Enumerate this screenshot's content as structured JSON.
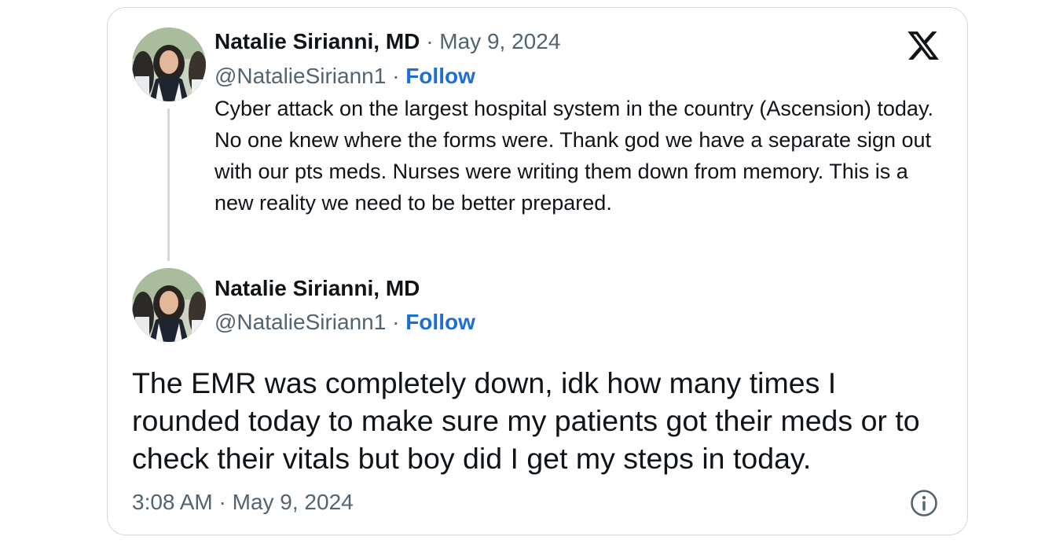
{
  "quoted_tweet": {
    "author_name": "Natalie Sirianni, MD",
    "date": "May 9, 2024",
    "handle": "@NatalieSiriann1",
    "follow_label": "Follow",
    "text": "Cyber attack on the largest hospital system in the country (Ascension) today. No one knew where the forms were. Thank god we have a separate sign out with our pts meds. Nurses were writing them down from memory. This is a new reality we need to be better prepared."
  },
  "main_tweet": {
    "author_name": "Natalie Sirianni, MD",
    "handle": "@NatalieSiriann1",
    "follow_label": "Follow",
    "text": "The EMR was completely down, idk how many times I rounded today to make sure my patients got their meds or to check their vitals but boy did I get my steps in today.",
    "timestamp": "3:08 AM · May 9, 2024"
  },
  "separator": "·",
  "icons": {
    "brand": "x-logo-icon",
    "info": "info-icon"
  },
  "colors": {
    "link": "#1d6fd6",
    "muted": "#536471",
    "border": "#cfd9de"
  }
}
